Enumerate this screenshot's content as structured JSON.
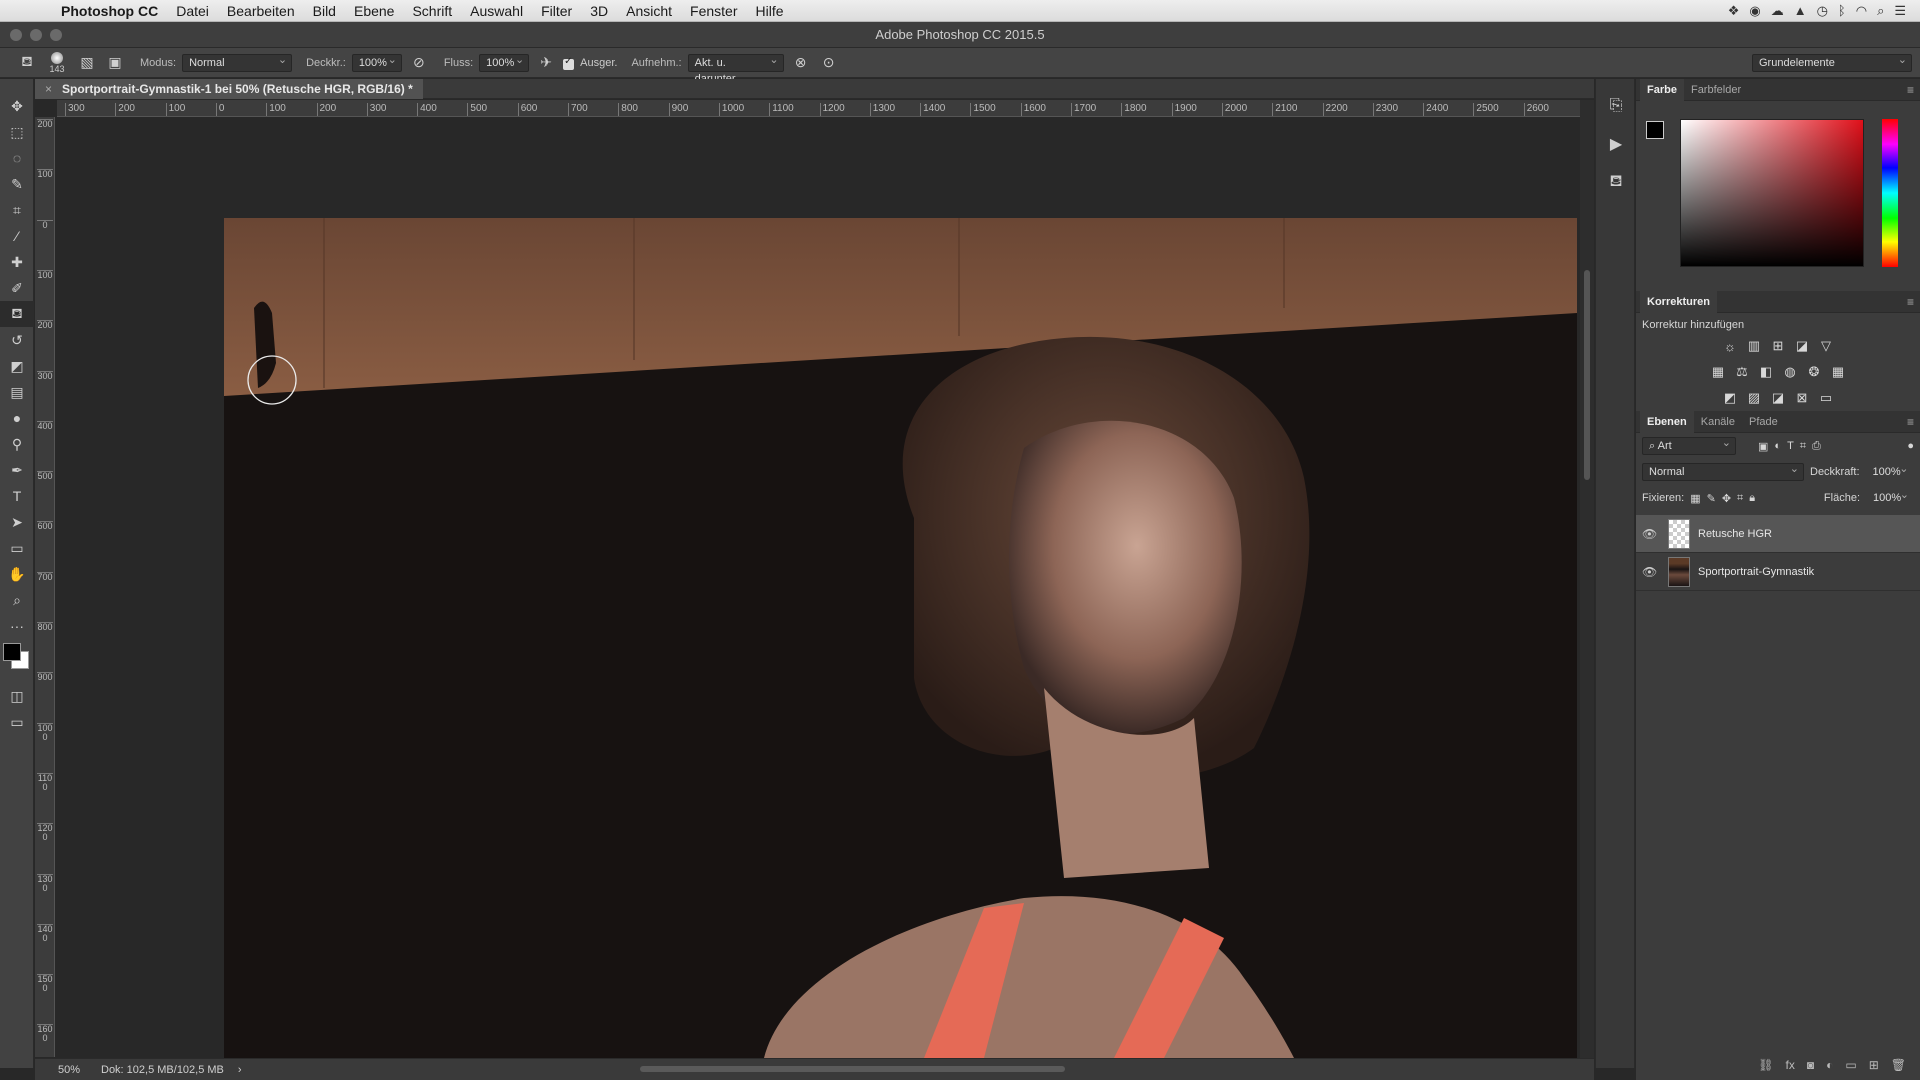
{
  "menubar": {
    "app": "Photoshop CC",
    "items": [
      "Datei",
      "Bearbeiten",
      "Bild",
      "Ebene",
      "Schrift",
      "Auswahl",
      "Filter",
      "3D",
      "Ansicht",
      "Fenster",
      "Hilfe"
    ]
  },
  "window": {
    "title": "Adobe Photoshop CC 2015.5"
  },
  "options": {
    "brush_size": "143",
    "mode_label": "Modus:",
    "mode_value": "Normal",
    "opacity_label": "Deckkr.:",
    "opacity_value": "100%",
    "flow_label": "Fluss:",
    "flow_value": "100%",
    "aligned_label": "Ausger.",
    "sample_label": "Aufnehm.:",
    "sample_value": "Akt. u. darunter",
    "workspace": "Grundelemente"
  },
  "document": {
    "tab_title": "Sportportrait-Gymnastik-1 bei 50% (Retusche HGR, RGB/16) *",
    "zoom": "50%",
    "doc_info": "Dok: 102,5 MB/102,5 MB"
  },
  "ruler": {
    "h_ticks": [
      "300",
      "200",
      "100",
      "0",
      "100",
      "200",
      "300",
      "400",
      "500",
      "600",
      "700",
      "800",
      "900",
      "1000",
      "1100",
      "1200",
      "1300",
      "1400",
      "1500",
      "1600",
      "1700",
      "1800",
      "1900",
      "2000",
      "2100",
      "2200",
      "2300",
      "2400",
      "2500",
      "2600"
    ],
    "v_ticks": [
      "200",
      "100",
      "0",
      "100",
      "200",
      "300",
      "400",
      "500",
      "600",
      "700",
      "800",
      "900",
      "1000",
      "1100",
      "1200",
      "1300",
      "1400",
      "1500",
      "1600"
    ]
  },
  "color_panel": {
    "tabs": [
      "Farbe",
      "Farbfelder"
    ]
  },
  "adjustments": {
    "title": "Korrekturen",
    "subtitle": "Korrektur hinzufügen"
  },
  "layers_panel": {
    "tabs": [
      "Ebenen",
      "Kanäle",
      "Pfade"
    ],
    "filter": "Art",
    "blend_mode": "Normal",
    "opacity_label": "Deckkraft:",
    "opacity_value": "100%",
    "lock_label": "Fixieren:",
    "fill_label": "Fläche:",
    "fill_value": "100%",
    "layers": [
      {
        "name": "Retusche HGR",
        "selected": true
      },
      {
        "name": "Sportportrait-Gymnastik",
        "selected": false
      }
    ]
  },
  "colors": {
    "accent": "#565656",
    "fg": "#000000",
    "bg": "#ffffff"
  },
  "icons": {
    "tools": [
      "move-icon",
      "marquee-icon",
      "lasso-icon",
      "quick-select-icon",
      "crop-icon",
      "eyedropper-icon",
      "healing-icon",
      "brush-icon",
      "clone-stamp-icon",
      "history-brush-icon",
      "eraser-icon",
      "gradient-icon",
      "blur-icon",
      "dodge-icon",
      "pen-icon",
      "type-icon",
      "path-select-icon",
      "rectangle-icon",
      "hand-icon",
      "zoom-icon",
      "more-icon"
    ]
  }
}
